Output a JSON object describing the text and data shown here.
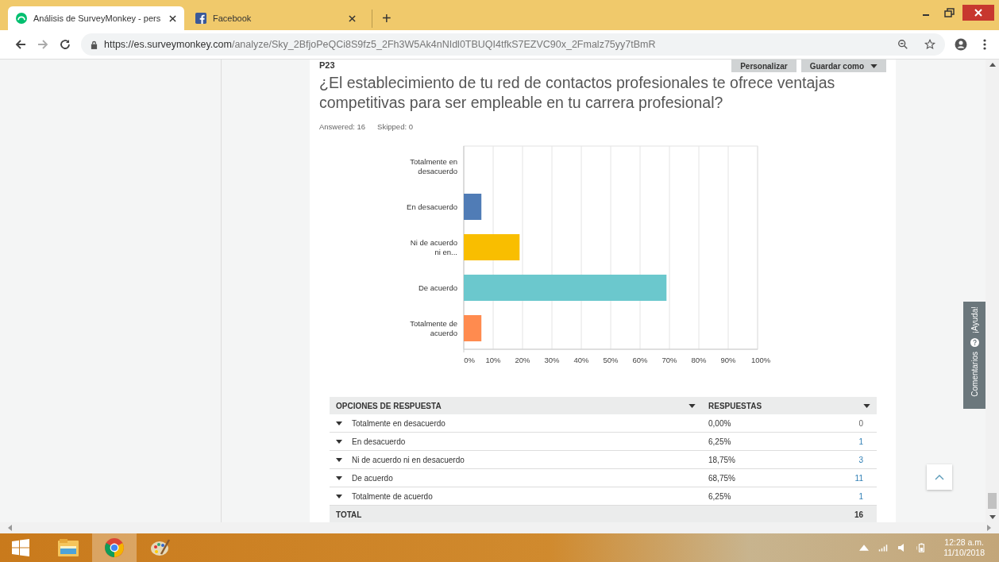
{
  "browser": {
    "tabs": [
      {
        "title": "Análisis de SurveyMonkey - pers",
        "kind": "monkey",
        "selected": true
      },
      {
        "title": "Facebook",
        "kind": "facebook",
        "selected": false
      }
    ],
    "new_tab": "+",
    "address": {
      "host": "https://es.surveymonkey.com",
      "path": "/analyze/Sky_2BfjoPeQCi8S9fz5_2Fh3W5Ak4nNIdl0TBUQI4tfkS7EZVC90x_2Fmalz75yy7tBmR"
    }
  },
  "question": {
    "number": "P23",
    "title": "¿El establecimiento de tu red de contactos profesionales te ofrece ventajas competitivas para ser empleable en tu carrera profesional?",
    "answered": "Answered: 16",
    "skipped": "Skipped: 0"
  },
  "actions": [
    {
      "label": "Personalizar",
      "menu": false
    },
    {
      "label": "Guardar como",
      "menu": true
    }
  ],
  "chart_data": {
    "type": "bar",
    "orientation": "horizontal",
    "categories": [
      "Totalmente en desacuerdo",
      "En desacuerdo",
      "Ni de acuerdo ni en...",
      "De acuerdo",
      "Totalmente de acuerdo"
    ],
    "series": [
      {
        "values": [
          0,
          6,
          19,
          69,
          6
        ]
      }
    ],
    "grid": true,
    "colors": [
      null,
      "#507cb6",
      "#f9be00",
      "#6bc8cd",
      "#ff8b4f"
    ],
    "xlim": [
      0,
      100
    ],
    "xticks": [
      {
        "value": 0,
        "label": "0%"
      },
      {
        "value": 10,
        "label": "10%"
      },
      {
        "value": 20,
        "label": "20%"
      },
      {
        "value": 30,
        "label": "30%"
      },
      {
        "value": 40,
        "label": "40%"
      },
      {
        "value": 50,
        "label": "50%"
      },
      {
        "value": 60,
        "label": "60%"
      },
      {
        "value": 70,
        "label": "70%"
      },
      {
        "value": 80,
        "label": "80%"
      },
      {
        "value": 90,
        "label": "90%"
      },
      {
        "value": 100,
        "label": "100%"
      }
    ]
  },
  "table": {
    "columns": [
      "OPCIONES DE RESPUESTA",
      "RESPUESTAS"
    ],
    "rows": [
      {
        "option": "Totalmente en desacuerdo",
        "percent": "0,00%",
        "count": "0",
        "link": false
      },
      {
        "option": "En desacuerdo",
        "percent": "6,25%",
        "count": "1",
        "link": true
      },
      {
        "option": "Ni de acuerdo ni en desacuerdo",
        "percent": "18,75%",
        "count": "3",
        "link": true
      },
      {
        "option": "De acuerdo",
        "percent": "68,75%",
        "count": "11",
        "link": true
      },
      {
        "option": "Totalmente de acuerdo",
        "percent": "6,25%",
        "count": "1",
        "link": true
      }
    ],
    "total": {
      "label": "TOTAL",
      "count": "16"
    }
  },
  "feedback_tab": {
    "help": "¡Ayuda!",
    "comments": "Comentarios"
  },
  "taskbar": {
    "apps": [
      {
        "kind": "explorer",
        "active": false
      },
      {
        "kind": "chrome",
        "active": true
      },
      {
        "kind": "paint",
        "active": false
      }
    ],
    "time": "12:28 a.m.",
    "date": "11/10/2018"
  }
}
